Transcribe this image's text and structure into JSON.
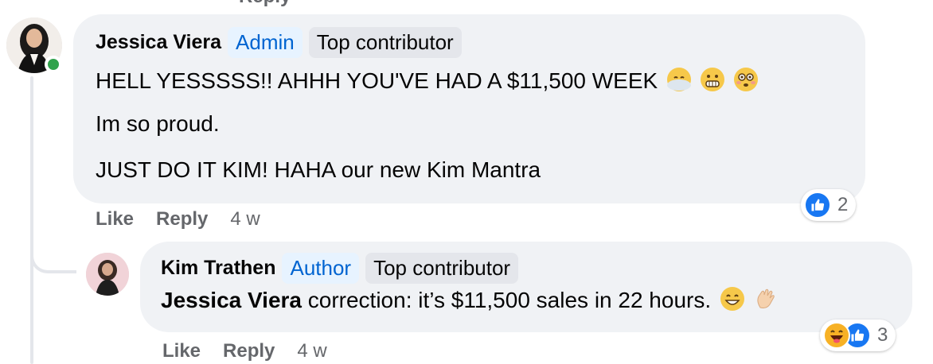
{
  "comments": [
    {
      "author": "Jessica Viera",
      "role_badge": "Admin",
      "contributor_badge": "Top contributor",
      "online": true,
      "lines": [
        "HELL YESSSSS!! AHHH YOU'VE HAD A $11,500 WEEK",
        "Im so proud.",
        "JUST DO IT KIM! HAHA our new Kim Mantra"
      ],
      "line1_emojis": [
        "face-in-clouds-emoji",
        "grimacing-face-emoji",
        "flushed-face-emoji"
      ],
      "actions": {
        "like": "Like",
        "reply": "Reply",
        "time": "4 w"
      },
      "reactions": {
        "icons": [
          "like-icon"
        ],
        "count": "2"
      }
    },
    {
      "author": "Kim Trathen",
      "role_badge": "Author",
      "contributor_badge": "Top contributor",
      "mention": "Jessica Viera",
      "body": " correction: it’s $11,500 sales in 22 hours.",
      "body_emojis": [
        "grinning-face-emoji",
        "waving-hand-emoji"
      ],
      "actions": {
        "like": "Like",
        "reply": "Reply",
        "time": "4 w"
      },
      "reactions": {
        "icons": [
          "haha-icon",
          "like-icon"
        ],
        "count": "3"
      }
    }
  ],
  "top_stub": "Reply",
  "colors": {
    "bubble": "#f0f2f5",
    "accent": "#0064d1",
    "like": "#1877f2",
    "online": "#31a24c"
  }
}
